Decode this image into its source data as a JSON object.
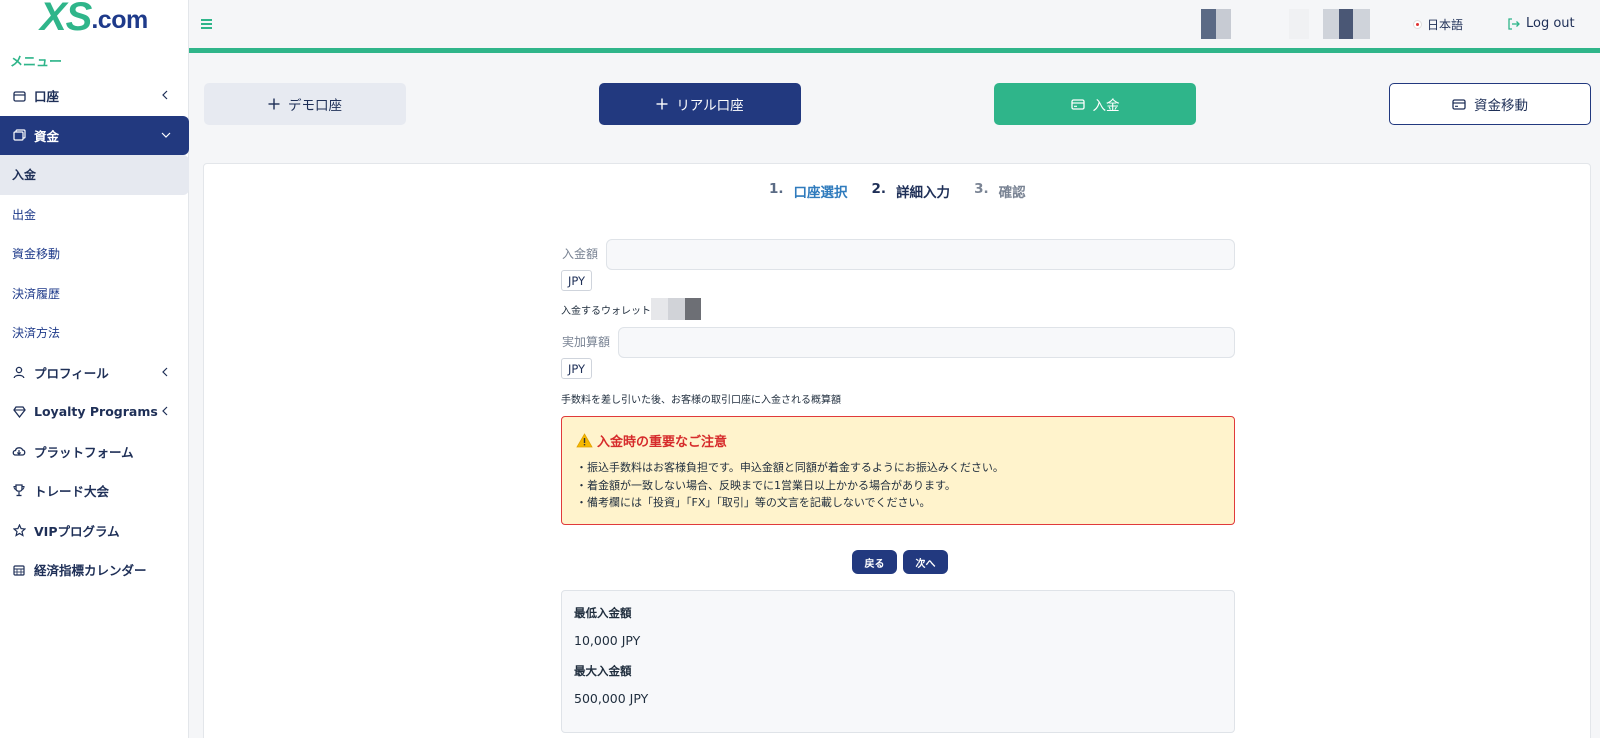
{
  "brand": {
    "logo_main": "XS",
    "logo_suffix": ".com"
  },
  "sidebar": {
    "menu_title": "メニュー",
    "items": [
      {
        "label": "口座",
        "icon": "wallet-icon",
        "expandable": true
      },
      {
        "label": "資金",
        "icon": "funds-icon",
        "expandable": true,
        "active": true,
        "children": [
          "入金",
          "出金",
          "資金移動",
          "決済履歴",
          "決済方法"
        ]
      },
      {
        "label": "プロフィール",
        "icon": "user-icon",
        "expandable": true
      },
      {
        "label": "Loyalty Programs",
        "icon": "diamond-icon",
        "expandable": true
      },
      {
        "label": "プラットフォーム",
        "icon": "cloud-download-icon"
      },
      {
        "label": "トレード大会",
        "icon": "trophy-icon"
      },
      {
        "label": "VIPプログラム",
        "icon": "star-icon"
      },
      {
        "label": "経済指標カレンダー",
        "icon": "calendar-icon"
      }
    ]
  },
  "header": {
    "language": "日本語",
    "logout": "Log out"
  },
  "actions": {
    "demo": "デモ口座",
    "real": "リアル口座",
    "deposit": "入金",
    "transfer": "資金移動"
  },
  "steps": [
    {
      "num": "1.",
      "label": "口座選択"
    },
    {
      "num": "2.",
      "label": "詳細入力"
    },
    {
      "num": "3.",
      "label": "確認"
    }
  ],
  "form": {
    "amount_label": "入金額",
    "amount_value": "",
    "currency": "JPY",
    "wallet_label": "入金するウォレット",
    "actual_label": "実加算額",
    "actual_value": "",
    "note": "手数料を差し引いた後、お客様の取引口座に入金される概算額"
  },
  "notice": {
    "title": "入金時の重要なご注意",
    "lines": [
      "・振込手数料はお客様負担です。申込金額と同額が着金するようにお振込みください。",
      "・着金額が一致しない場合、反映までに1営業日以上かかる場合があります。",
      "・備考欄には「投資」「FX」「取引」等の文言を記載しないでください。"
    ]
  },
  "buttons": {
    "back": "戻る",
    "next": "次へ"
  },
  "limits": {
    "min_label": "最低入金額",
    "min_value": "10,000 JPY",
    "max_label": "最大入金額",
    "max_value": "500,000 JPY"
  },
  "colors": {
    "brand_green": "#2fb58a",
    "brand_navy": "#22397f",
    "warning_red": "#d62b2b",
    "notice_bg": "#fff3cc"
  }
}
